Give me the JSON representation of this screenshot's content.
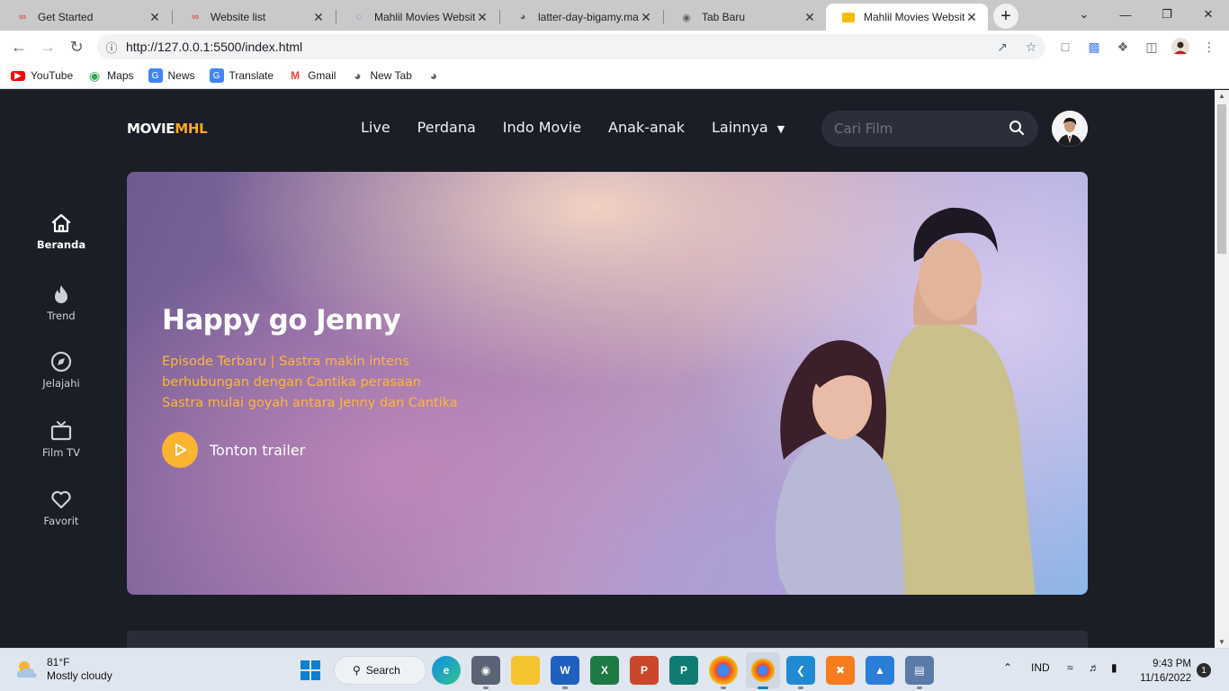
{
  "browser": {
    "tabs": [
      {
        "label": "Get Started",
        "icon": "red-swirl-icon"
      },
      {
        "label": "Website list",
        "icon": "red-swirl-icon"
      },
      {
        "label": "Mahlil Movies Website",
        "icon": "loading-icon"
      },
      {
        "label": "latter-day-bigamy.mat",
        "icon": "globe-icon"
      },
      {
        "label": "Tab Baru",
        "icon": "chrome-icon"
      },
      {
        "label": "Mahlil Movies Website",
        "icon": "folder-icon",
        "active": true
      }
    ],
    "url": "http://127.0.0.1:5500/index.html",
    "bookmarks": [
      {
        "label": "YouTube",
        "icon": "youtube-icon",
        "color": "#ff0000"
      },
      {
        "label": "Maps",
        "icon": "maps-icon",
        "color": "#34a853"
      },
      {
        "label": "News",
        "icon": "news-icon",
        "color": "#4285f4"
      },
      {
        "label": "Translate",
        "icon": "translate-icon",
        "color": "#4285f4"
      },
      {
        "label": "Gmail",
        "icon": "gmail-icon",
        "color": "#ea4335"
      },
      {
        "label": "New Tab",
        "icon": "globe-icon",
        "color": "#5f6368"
      }
    ]
  },
  "site": {
    "logo_main": "MOVIE",
    "logo_accent": "MHL",
    "accent_color": "#f9a825",
    "nav": [
      "Live",
      "Perdana",
      "Indo Movie",
      "Anak-anak",
      "Lainnya"
    ],
    "search_placeholder": "Cari Film",
    "sidebar": [
      {
        "label": "Beranda",
        "icon": "home-icon",
        "active": true
      },
      {
        "label": "Trend",
        "icon": "fire-icon"
      },
      {
        "label": "Jelajahi",
        "icon": "compass-icon"
      },
      {
        "label": "Film TV",
        "icon": "tv-icon"
      },
      {
        "label": "Favorit",
        "icon": "heart-icon"
      }
    ],
    "hero": {
      "title": "Happy go Jenny",
      "desc_lines": [
        "Episode Terbaru | Sastra makin intens",
        "berhubungan dengan Cantika perasaan",
        "Sastra mulai goyah antara Jenny dan Cantika"
      ],
      "trailer_label": "Tonton trailer"
    }
  },
  "taskbar": {
    "weather_temp": "81°F",
    "weather_desc": "Mostly cloudy",
    "search_label": "Search",
    "lang": "IND",
    "time": "9:43 PM",
    "date": "11/16/2022",
    "notifications": "1"
  }
}
